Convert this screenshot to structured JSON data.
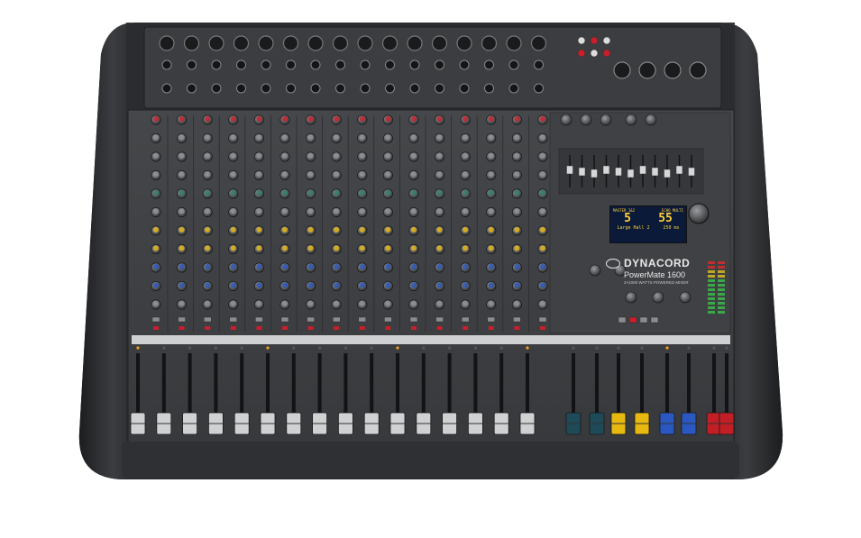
{
  "brand": {
    "name": "DYNACORD",
    "model": "PowerMate 1600",
    "subtitle": "2×1000 WATTS POWERED MIXER"
  },
  "display": {
    "left_header": "MASTER 1&2",
    "right_header": "ECHO MULTI",
    "left_number": "5",
    "right_number": "55",
    "left_name": "Large Hall 2",
    "right_name": "250 ms"
  },
  "mixer": {
    "mono_channels": 12,
    "stereo_channels": 4,
    "knob_rows": 9,
    "fader_count": 26,
    "eq_bands": 11,
    "colors": {
      "body": "#3a3c3f",
      "frame": "#2a2c2e",
      "knob_red": "#c8202a",
      "knob_yellow": "#e2b215",
      "knob_blue": "#2a56b8",
      "knob_green": "#2f7d6b",
      "knob_grey": "#8c8f92",
      "fader_dark": "#1f4a57",
      "fader_yellow": "#e6b810",
      "fader_blue": "#2a58c0",
      "fader_red": "#c21e26"
    }
  }
}
